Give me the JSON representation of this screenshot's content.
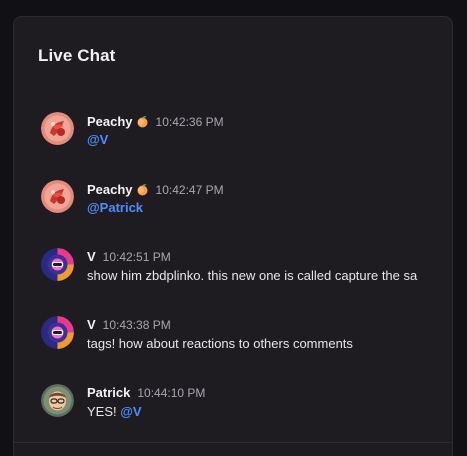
{
  "panel": {
    "title": "Live Chat"
  },
  "messages": [
    {
      "author": "Peachy",
      "author_emoji": "peach-emoji",
      "time": "10:42:36 PM",
      "mention": "@V",
      "text": "",
      "avatar": "peachy-avatar"
    },
    {
      "author": "Peachy",
      "author_emoji": "peach-emoji",
      "time": "10:42:47 PM",
      "mention": "@Patrick",
      "text": "",
      "avatar": "peachy-avatar"
    },
    {
      "author": "V",
      "time": "10:42:51 PM",
      "text": "show him zbdplinko. this new one is called capture the sa",
      "avatar": "v-avatar"
    },
    {
      "author": "V",
      "time": "10:43:38 PM",
      "text": "tags! how about reactions to others comments",
      "avatar": "v-avatar"
    },
    {
      "author": "Patrick",
      "time": "10:44:10 PM",
      "text": "YES!",
      "mention": "@V",
      "avatar": "patrick-avatar"
    }
  ],
  "colors": {
    "background": "#111014",
    "panel": "#1f1c21",
    "mention": "#4c8dff",
    "timestamp": "#a9a5ae"
  }
}
